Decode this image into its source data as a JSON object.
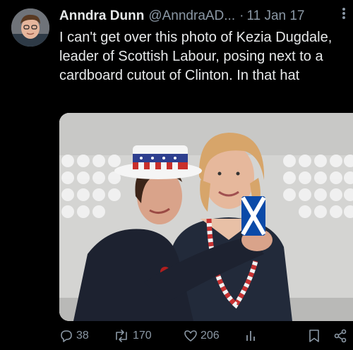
{
  "tweet": {
    "display_name": "Anndra Dunn",
    "handle": "@AnndraAD...",
    "separator": "·",
    "date": "11 Jan 17",
    "more_icon": "more-dots-icon",
    "text": "I can't get over this photo of Kezia Dugdale, leader of Scottish Labour, posing next to a cardboard cutout of Clinton. In that hat"
  },
  "avatar": {
    "icon": "user-avatar"
  },
  "media": {
    "type": "photo",
    "description_icon": "tweet-photo"
  },
  "actions": {
    "reply": {
      "icon": "reply-icon",
      "count": "38"
    },
    "retweet": {
      "icon": "retweet-icon",
      "count": "170"
    },
    "like": {
      "icon": "heart-icon",
      "count": "206"
    },
    "views": {
      "icon": "views-chart-icon"
    },
    "bookmark": {
      "icon": "bookmark-icon"
    },
    "share": {
      "icon": "share-icon"
    }
  },
  "colors": {
    "background": "#000000",
    "text_primary": "#e7e9ea",
    "text_secondary": "#8b98a5"
  }
}
